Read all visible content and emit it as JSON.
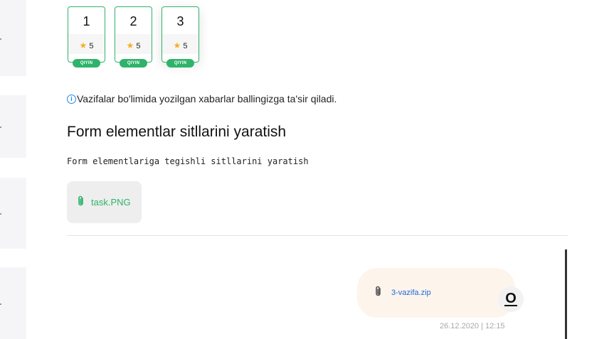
{
  "rail": {
    "count": 5
  },
  "tasks": [
    {
      "number": "1",
      "score": "5",
      "badge": "QIYIN",
      "star_icon": "star-icon"
    },
    {
      "number": "2",
      "score": "5",
      "badge": "QIYIN",
      "star_icon": "star-icon"
    },
    {
      "number": "3",
      "score": "5",
      "badge": "QIYIN",
      "star_icon": "star-icon"
    }
  ],
  "notice": {
    "text": "Vazifalar bo'limida yozilgan xabarlar ballingizga ta'sir qiladi.",
    "icon": "info-icon"
  },
  "task": {
    "title": "Form elementlar sitllarini yaratish",
    "description": "Form elementlariga tegishli sitllarini yaratish",
    "attachment": {
      "name": "task.PNG",
      "icon": "paperclip-icon"
    }
  },
  "message": {
    "file": "3-vazifa.zip",
    "timestamp": "26.12.2020 | 12:15",
    "avatar_letter": "O"
  },
  "colors": {
    "accent_green": "#2fb36a",
    "link_blue": "#1e6bd6",
    "star": "#f5b021",
    "bubble_bg": "#fdf4ec"
  }
}
